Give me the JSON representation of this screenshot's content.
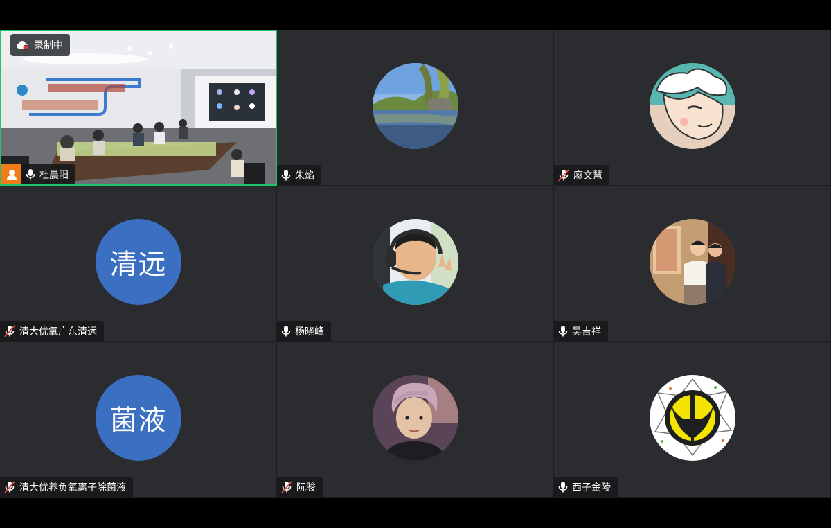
{
  "recording": {
    "label": "录制中",
    "icon": "cloud-recording-icon"
  },
  "participants": [
    {
      "name": "杜晨阳",
      "mic": "on",
      "host": true,
      "avatar_type": "video"
    },
    {
      "name": "朱焰",
      "mic": "on",
      "avatar_type": "photo",
      "avatar_desc": "lake-landscape"
    },
    {
      "name": "廖文慧",
      "mic": "muted",
      "avatar_type": "photo",
      "avatar_desc": "cartoon-character"
    },
    {
      "name": "清大优氧广东清远",
      "mic": "muted",
      "avatar_type": "text",
      "avatar_text": "清远"
    },
    {
      "name": "杨晓峰",
      "mic": "on",
      "avatar_type": "photo",
      "avatar_desc": "person-with-headset"
    },
    {
      "name": "吴吉祥",
      "mic": "on",
      "avatar_type": "photo",
      "avatar_desc": "two-men-portrait"
    },
    {
      "name": "清大优养负氧离子除菌液",
      "mic": "muted",
      "avatar_type": "text",
      "avatar_text": "菌液"
    },
    {
      "name": "阮骏",
      "mic": "muted",
      "avatar_type": "photo",
      "avatar_desc": "selfie-portrait"
    },
    {
      "name": "西子金陵",
      "mic": "on",
      "avatar_type": "photo",
      "avatar_desc": "emblem-logo"
    }
  ],
  "colors": {
    "active_border": "#1fc46b",
    "tile_bg": "#2a2c30",
    "text_avatar_bg": "#3b6fc2",
    "host_badge": "#f07c1a",
    "muted_slash": "#e04848"
  }
}
